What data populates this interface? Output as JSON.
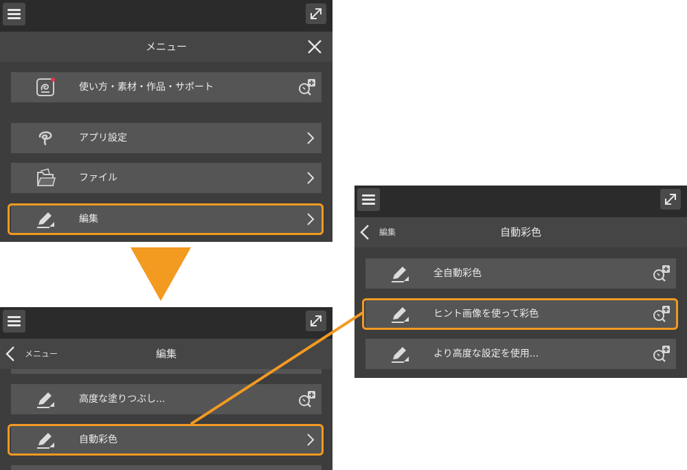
{
  "panel_top_left": {
    "title": "メニュー",
    "items": [
      {
        "label": "使い方・素材・作品・サポート",
        "icon": "app-support-icon",
        "action": "zoom"
      },
      {
        "label": "アプリ設定",
        "icon": "clip-logo-icon",
        "action": "chevron"
      },
      {
        "label": "ファイル",
        "icon": "folder-icon",
        "action": "chevron"
      },
      {
        "label": "編集",
        "icon": "pencil-icon",
        "action": "chevron"
      }
    ]
  },
  "panel_bottom_left": {
    "back_label": "メニュー",
    "title": "編集",
    "items": [
      {
        "label": "高度な塗りつぶし...",
        "icon": "pencil-icon",
        "action": "zoom"
      },
      {
        "label": "自動彩色",
        "icon": "pencil-icon",
        "action": "chevron"
      }
    ]
  },
  "panel_right": {
    "back_label": "編集",
    "title": "自動彩色",
    "items": [
      {
        "label": "全自動彩色",
        "icon": "pencil-icon",
        "action": "zoom"
      },
      {
        "label": "ヒント画像を使って彩色",
        "icon": "pencil-icon",
        "action": "zoom"
      },
      {
        "label": "より高度な設定を使用...",
        "icon": "pencil-icon",
        "action": "zoom"
      }
    ]
  },
  "colors": {
    "highlight": "#f39a21",
    "panel_bg": "#3d3d3d",
    "item_bg": "#555555",
    "topbar_bg": "#2b2b2b",
    "text": "#ececec"
  }
}
